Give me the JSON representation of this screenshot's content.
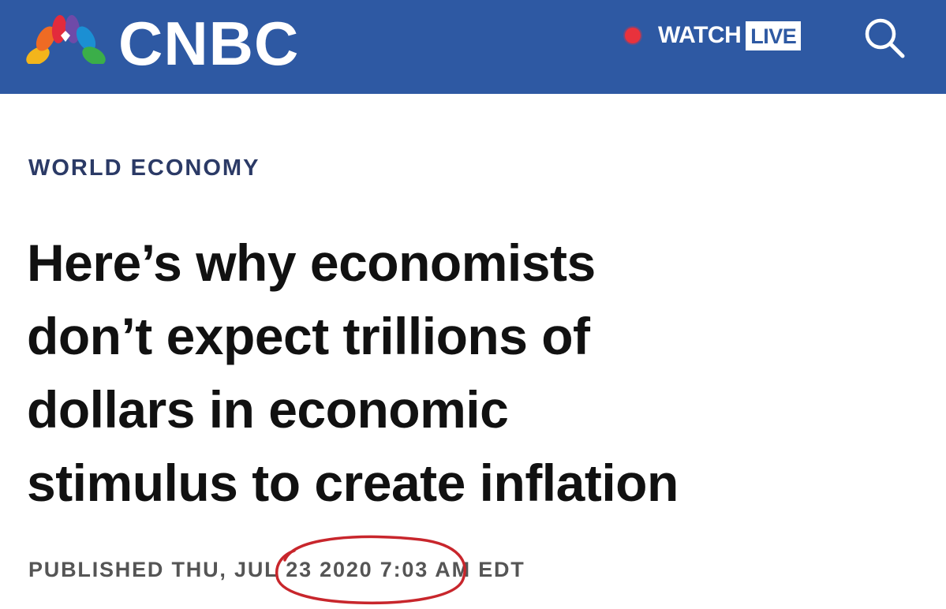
{
  "header": {
    "logo_text": "CNBC",
    "watch_label": "WATCH",
    "live_label": "LIVE",
    "search_icon": "search-icon",
    "peacock_icon": "nbc-peacock-icon",
    "live_dot_icon": "live-dot-icon",
    "colors": {
      "bar": "#2e59a3",
      "live_dot": "#e8323c"
    }
  },
  "article": {
    "section": "WORLD ECONOMY",
    "headline_lines": [
      "Here’s why economists",
      "don’t expect trillions of",
      "dollars in economic",
      "stimulus to create inflation"
    ],
    "published": {
      "prefix": "PUBLISHED THU,",
      "date": "JUL 23 2020",
      "time": "7:03 AM EDT"
    },
    "annotation_color": "#c8262c"
  }
}
